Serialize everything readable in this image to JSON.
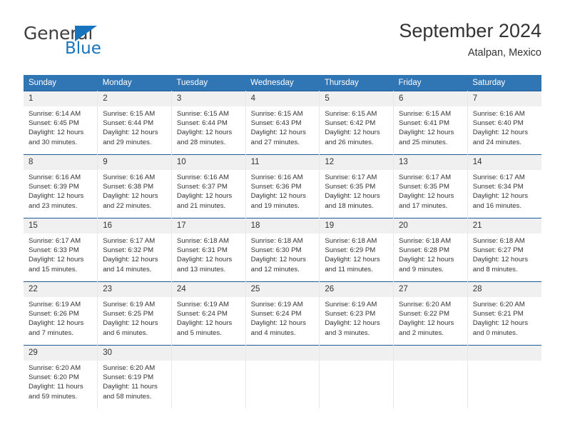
{
  "logo": {
    "word_one": "General",
    "word_two": "Blue",
    "triangle_icon": "triangle-icon",
    "accent_color": "#1874bd"
  },
  "header": {
    "title": "September 2024",
    "subtitle": "Atalpan, Mexico"
  },
  "theme": {
    "header_blue": "#3075b4",
    "row_divider": "#205c99",
    "daynum_band": "#f0f0f0",
    "text": "#333333"
  },
  "calendar": {
    "weekday_headers": [
      "Sunday",
      "Monday",
      "Tuesday",
      "Wednesday",
      "Thursday",
      "Friday",
      "Saturday"
    ],
    "weeks": [
      [
        {
          "day": "1",
          "sunrise": "Sunrise: 6:14 AM",
          "sunset": "Sunset: 6:45 PM",
          "daylight_line1": "Daylight: 12 hours",
          "daylight_line2": "and 30 minutes."
        },
        {
          "day": "2",
          "sunrise": "Sunrise: 6:15 AM",
          "sunset": "Sunset: 6:44 PM",
          "daylight_line1": "Daylight: 12 hours",
          "daylight_line2": "and 29 minutes."
        },
        {
          "day": "3",
          "sunrise": "Sunrise: 6:15 AM",
          "sunset": "Sunset: 6:44 PM",
          "daylight_line1": "Daylight: 12 hours",
          "daylight_line2": "and 28 minutes."
        },
        {
          "day": "4",
          "sunrise": "Sunrise: 6:15 AM",
          "sunset": "Sunset: 6:43 PM",
          "daylight_line1": "Daylight: 12 hours",
          "daylight_line2": "and 27 minutes."
        },
        {
          "day": "5",
          "sunrise": "Sunrise: 6:15 AM",
          "sunset": "Sunset: 6:42 PM",
          "daylight_line1": "Daylight: 12 hours",
          "daylight_line2": "and 26 minutes."
        },
        {
          "day": "6",
          "sunrise": "Sunrise: 6:15 AM",
          "sunset": "Sunset: 6:41 PM",
          "daylight_line1": "Daylight: 12 hours",
          "daylight_line2": "and 25 minutes."
        },
        {
          "day": "7",
          "sunrise": "Sunrise: 6:16 AM",
          "sunset": "Sunset: 6:40 PM",
          "daylight_line1": "Daylight: 12 hours",
          "daylight_line2": "and 24 minutes."
        }
      ],
      [
        {
          "day": "8",
          "sunrise": "Sunrise: 6:16 AM",
          "sunset": "Sunset: 6:39 PM",
          "daylight_line1": "Daylight: 12 hours",
          "daylight_line2": "and 23 minutes."
        },
        {
          "day": "9",
          "sunrise": "Sunrise: 6:16 AM",
          "sunset": "Sunset: 6:38 PM",
          "daylight_line1": "Daylight: 12 hours",
          "daylight_line2": "and 22 minutes."
        },
        {
          "day": "10",
          "sunrise": "Sunrise: 6:16 AM",
          "sunset": "Sunset: 6:37 PM",
          "daylight_line1": "Daylight: 12 hours",
          "daylight_line2": "and 21 minutes."
        },
        {
          "day": "11",
          "sunrise": "Sunrise: 6:16 AM",
          "sunset": "Sunset: 6:36 PM",
          "daylight_line1": "Daylight: 12 hours",
          "daylight_line2": "and 19 minutes."
        },
        {
          "day": "12",
          "sunrise": "Sunrise: 6:17 AM",
          "sunset": "Sunset: 6:35 PM",
          "daylight_line1": "Daylight: 12 hours",
          "daylight_line2": "and 18 minutes."
        },
        {
          "day": "13",
          "sunrise": "Sunrise: 6:17 AM",
          "sunset": "Sunset: 6:35 PM",
          "daylight_line1": "Daylight: 12 hours",
          "daylight_line2": "and 17 minutes."
        },
        {
          "day": "14",
          "sunrise": "Sunrise: 6:17 AM",
          "sunset": "Sunset: 6:34 PM",
          "daylight_line1": "Daylight: 12 hours",
          "daylight_line2": "and 16 minutes."
        }
      ],
      [
        {
          "day": "15",
          "sunrise": "Sunrise: 6:17 AM",
          "sunset": "Sunset: 6:33 PM",
          "daylight_line1": "Daylight: 12 hours",
          "daylight_line2": "and 15 minutes."
        },
        {
          "day": "16",
          "sunrise": "Sunrise: 6:17 AM",
          "sunset": "Sunset: 6:32 PM",
          "daylight_line1": "Daylight: 12 hours",
          "daylight_line2": "and 14 minutes."
        },
        {
          "day": "17",
          "sunrise": "Sunrise: 6:18 AM",
          "sunset": "Sunset: 6:31 PM",
          "daylight_line1": "Daylight: 12 hours",
          "daylight_line2": "and 13 minutes."
        },
        {
          "day": "18",
          "sunrise": "Sunrise: 6:18 AM",
          "sunset": "Sunset: 6:30 PM",
          "daylight_line1": "Daylight: 12 hours",
          "daylight_line2": "and 12 minutes."
        },
        {
          "day": "19",
          "sunrise": "Sunrise: 6:18 AM",
          "sunset": "Sunset: 6:29 PM",
          "daylight_line1": "Daylight: 12 hours",
          "daylight_line2": "and 11 minutes."
        },
        {
          "day": "20",
          "sunrise": "Sunrise: 6:18 AM",
          "sunset": "Sunset: 6:28 PM",
          "daylight_line1": "Daylight: 12 hours",
          "daylight_line2": "and 9 minutes."
        },
        {
          "day": "21",
          "sunrise": "Sunrise: 6:18 AM",
          "sunset": "Sunset: 6:27 PM",
          "daylight_line1": "Daylight: 12 hours",
          "daylight_line2": "and 8 minutes."
        }
      ],
      [
        {
          "day": "22",
          "sunrise": "Sunrise: 6:19 AM",
          "sunset": "Sunset: 6:26 PM",
          "daylight_line1": "Daylight: 12 hours",
          "daylight_line2": "and 7 minutes."
        },
        {
          "day": "23",
          "sunrise": "Sunrise: 6:19 AM",
          "sunset": "Sunset: 6:25 PM",
          "daylight_line1": "Daylight: 12 hours",
          "daylight_line2": "and 6 minutes."
        },
        {
          "day": "24",
          "sunrise": "Sunrise: 6:19 AM",
          "sunset": "Sunset: 6:24 PM",
          "daylight_line1": "Daylight: 12 hours",
          "daylight_line2": "and 5 minutes."
        },
        {
          "day": "25",
          "sunrise": "Sunrise: 6:19 AM",
          "sunset": "Sunset: 6:24 PM",
          "daylight_line1": "Daylight: 12 hours",
          "daylight_line2": "and 4 minutes."
        },
        {
          "day": "26",
          "sunrise": "Sunrise: 6:19 AM",
          "sunset": "Sunset: 6:23 PM",
          "daylight_line1": "Daylight: 12 hours",
          "daylight_line2": "and 3 minutes."
        },
        {
          "day": "27",
          "sunrise": "Sunrise: 6:20 AM",
          "sunset": "Sunset: 6:22 PM",
          "daylight_line1": "Daylight: 12 hours",
          "daylight_line2": "and 2 minutes."
        },
        {
          "day": "28",
          "sunrise": "Sunrise: 6:20 AM",
          "sunset": "Sunset: 6:21 PM",
          "daylight_line1": "Daylight: 12 hours",
          "daylight_line2": "and 0 minutes."
        }
      ],
      [
        {
          "day": "29",
          "sunrise": "Sunrise: 6:20 AM",
          "sunset": "Sunset: 6:20 PM",
          "daylight_line1": "Daylight: 11 hours",
          "daylight_line2": "and 59 minutes."
        },
        {
          "day": "30",
          "sunrise": "Sunrise: 6:20 AM",
          "sunset": "Sunset: 6:19 PM",
          "daylight_line1": "Daylight: 11 hours",
          "daylight_line2": "and 58 minutes."
        },
        {
          "day": "",
          "sunrise": "",
          "sunset": "",
          "daylight_line1": "",
          "daylight_line2": ""
        },
        {
          "day": "",
          "sunrise": "",
          "sunset": "",
          "daylight_line1": "",
          "daylight_line2": ""
        },
        {
          "day": "",
          "sunrise": "",
          "sunset": "",
          "daylight_line1": "",
          "daylight_line2": ""
        },
        {
          "day": "",
          "sunrise": "",
          "sunset": "",
          "daylight_line1": "",
          "daylight_line2": ""
        },
        {
          "day": "",
          "sunrise": "",
          "sunset": "",
          "daylight_line1": "",
          "daylight_line2": ""
        }
      ]
    ]
  }
}
